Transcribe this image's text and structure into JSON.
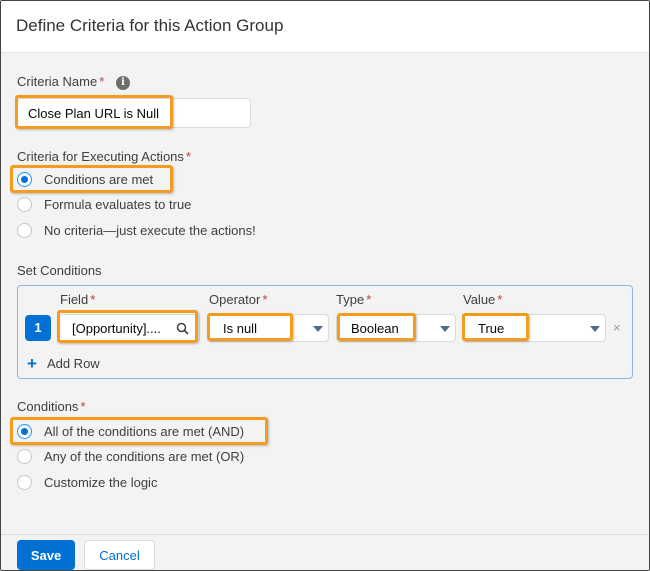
{
  "dialog": {
    "title": "Define Criteria for this Action Group"
  },
  "criteria_name": {
    "label": "Criteria Name",
    "required_mark": "*",
    "info_icon": "info-icon",
    "value": "Close Plan URL is Null"
  },
  "executing": {
    "label": "Criteria for Executing Actions",
    "required_mark": "*",
    "options": [
      {
        "label": "Conditions are met",
        "selected": true
      },
      {
        "label": "Formula evaluates to true",
        "selected": false
      },
      {
        "label": "No criteria—just execute the actions!",
        "selected": false
      }
    ]
  },
  "set_conditions": {
    "label": "Set Conditions",
    "columns": {
      "field": "Field",
      "operator": "Operator",
      "type": "Type",
      "value": "Value",
      "required_mark": "*"
    },
    "rows": [
      {
        "number": "1",
        "field": "[Opportunity]....",
        "operator": "Is null",
        "type": "Boolean",
        "value": "True"
      }
    ],
    "add_row_label": "Add Row",
    "remove_icon": "×"
  },
  "conditions": {
    "label": "Conditions",
    "required_mark": "*",
    "options": [
      {
        "label": "All of the conditions are met (AND)",
        "selected": true
      },
      {
        "label": "Any of the conditions are met (OR)",
        "selected": false
      },
      {
        "label": "Customize the logic",
        "selected": false
      }
    ]
  },
  "footer": {
    "save_label": "Save",
    "cancel_label": "Cancel"
  },
  "colors": {
    "brand": "#0070d2",
    "highlight": "#f49b20",
    "required": "#c23934"
  }
}
